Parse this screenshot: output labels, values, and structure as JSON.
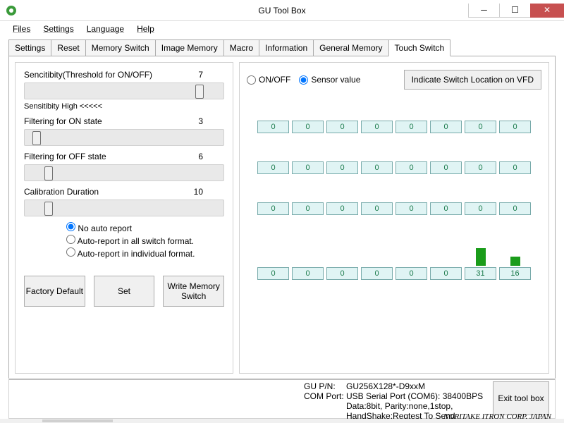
{
  "window": {
    "title": "GU Tool Box"
  },
  "menu": [
    "Files",
    "Settings",
    "Language",
    "Help"
  ],
  "tabs": [
    "Settings",
    "Reset",
    "Memory Switch",
    "Image Memory",
    "Macro",
    "Information",
    "General Memory",
    "Touch Switch"
  ],
  "active_tab": 7,
  "sliders": {
    "sensitivity": {
      "label": "Sencitibity(Threshold for ON/OFF)",
      "value": 7,
      "sub": "Sensitibity High <<<<<"
    },
    "filter_on": {
      "label": "Filtering for ON state",
      "value": 3
    },
    "filter_off": {
      "label": "Filtering for OFF state",
      "value": 6
    },
    "calibration": {
      "label": "Calibration Duration",
      "value": 10
    }
  },
  "report": {
    "selected": 0,
    "options": [
      "No auto report",
      "Auto-report in all switch format.",
      "Auto-report in individual format."
    ]
  },
  "buttons": {
    "factory": "Factory Default",
    "set": "Set",
    "wms": "Write Memory Switch"
  },
  "right": {
    "mode_onoff": "ON/OFF",
    "mode_sensor": "Sensor value",
    "mode_selected": 1,
    "vfd_btn": "Indicate Switch Location on VFD"
  },
  "chart_data": {
    "type": "bar",
    "rows": [
      [
        0,
        0,
        0,
        0,
        0,
        0,
        0,
        0
      ],
      [
        0,
        0,
        0,
        0,
        0,
        0,
        0,
        0
      ],
      [
        0,
        0,
        0,
        0,
        0,
        0,
        0,
        0
      ],
      [
        0,
        0,
        0,
        0,
        0,
        0,
        31,
        16
      ]
    ],
    "max_for_bar_scale": 40
  },
  "footer": {
    "pn_label": "GU P/N:",
    "pn": "GU256X128*-D9xxM",
    "com_label": "COM Port:",
    "com_lines": [
      "USB Serial Port (COM6):  38400BPS",
      "Data:8bit, Parity:none,1stop,",
      "HandShake:Reqtest To Send"
    ],
    "exit": "Exit tool box"
  },
  "corp": "NORITAKE ITRON CORP. JAPAN"
}
